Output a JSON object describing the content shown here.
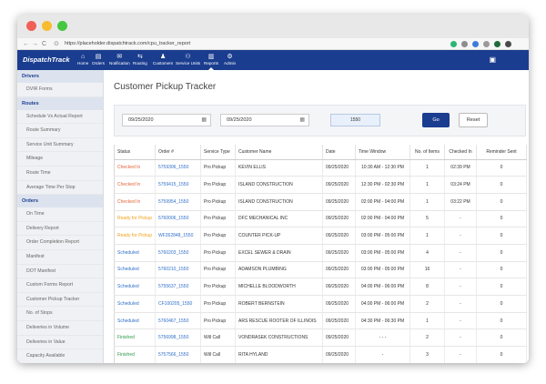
{
  "browser": {
    "url": "https://placeholder.dispatchtrack.com/cpu_tracker_report",
    "nav": {
      "back": "←",
      "forward": "→",
      "reload": "C",
      "lock": "⊙"
    },
    "extensions": [
      {
        "name": "ext-green",
        "color": "#2bb673"
      },
      {
        "name": "ext-gray",
        "color": "#8d8d8d"
      },
      {
        "name": "ext-blue",
        "color": "#3d7dd8"
      },
      {
        "name": "ext-puzzle",
        "color": "#9a9a9a"
      },
      {
        "name": "ext-darkgreen",
        "color": "#1f6b3a"
      },
      {
        "name": "ext-profile",
        "color": "#4a4a4a"
      }
    ]
  },
  "app": {
    "logo": "DispatchTrack",
    "nav": [
      {
        "label": "Home",
        "icon": "home-icon",
        "glyph": "⌂"
      },
      {
        "label": "Orders",
        "icon": "orders-icon",
        "glyph": "▤"
      },
      {
        "label": "Notification",
        "icon": "notification-icon",
        "glyph": "✉"
      },
      {
        "label": "Routing",
        "icon": "routing-icon",
        "glyph": "⇆"
      },
      {
        "label": "Customers",
        "icon": "customers-icon",
        "glyph": "♟"
      },
      {
        "label": "Service Units",
        "icon": "service-units-icon",
        "glyph": "⚇"
      },
      {
        "label": "Reports",
        "icon": "reports-icon",
        "glyph": "▥"
      },
      {
        "label": "Admin",
        "icon": "admin-icon",
        "glyph": "⚙"
      }
    ],
    "active_nav": "Reports",
    "user_glyph": "▣",
    "brand_color": "#1b3d8f"
  },
  "sidebar": {
    "sections": [
      {
        "title": "Drivers",
        "items": [
          "DVIR Forms"
        ]
      },
      {
        "title": "Routes",
        "items": [
          "Schedule Vs Actual Report",
          "Route Summary",
          "Service Unit Summary",
          "Mileage",
          "Route Time",
          "Average Time Per Stop"
        ]
      },
      {
        "title": "Orders",
        "items": [
          "On Time",
          "Delivery Report",
          "Order Completion Report",
          "Manifest",
          "DOT Manifest",
          "Custom Forms Report",
          "Customer Pickup Tracker",
          "No. of Stops",
          "Deliveries in Volume",
          "Deliveries in Value",
          "Capacity Available"
        ]
      }
    ]
  },
  "main": {
    "title": "Customer Pickup Tracker",
    "filters": {
      "start_date": "09/25/2020",
      "end_date": "09/25/2020",
      "store": "1550",
      "calendar_glyph": "▦",
      "go_label": "Go",
      "reset_label": "Reset"
    },
    "table": {
      "columns": [
        "Status",
        "Order #",
        "Service Type",
        "Customer Name",
        "Date",
        "Time Window",
        "No. of Items",
        "Checked In",
        "Reminder Sent"
      ],
      "rows": [
        {
          "status": "Checked In",
          "status_class": "st-checked",
          "order": "5759306_1550",
          "service": "Pro Pickup",
          "customer": "KEVIN ELLIS",
          "date": "09/25/2020",
          "window": "10:30 AM - 12:30 PM",
          "items": "1",
          "checked_in": "02:39 PM",
          "reminder": "0"
        },
        {
          "status": "Checked In",
          "status_class": "st-checked",
          "order": "5759415_1550",
          "service": "Pro Pickup",
          "customer": "ISLAND CONSTRUCTION",
          "date": "09/25/2020",
          "window": "12:30 PM - 02:30 PM",
          "items": "1",
          "checked_in": "03:24 PM",
          "reminder": "0"
        },
        {
          "status": "Checked In",
          "status_class": "st-checked",
          "order": "5759954_1550",
          "service": "Pro Pickup",
          "customer": "ISLAND CONSTRUCTION",
          "date": "09/25/2020",
          "window": "02:00 PM - 04:00 PM",
          "items": "1",
          "checked_in": "03:22 PM",
          "reminder": "0"
        },
        {
          "status": "Ready for Pickup",
          "status_class": "st-ready",
          "order": "5760006_1550",
          "service": "Pro Pickup",
          "customer": "DFC MECHANICAL INC",
          "date": "09/25/2020",
          "window": "02:00 PM - 04:00 PM",
          "items": "5",
          "checked_in": "-",
          "reminder": "0"
        },
        {
          "status": "Ready for Pickup",
          "status_class": "st-ready",
          "order": "WF262848_1550",
          "service": "Pro Pickup",
          "customer": "COUNTER PICK-UP",
          "date": "09/25/2020",
          "window": "03:00 PM - 05:00 PM",
          "items": "1",
          "checked_in": "-",
          "reminder": "0"
        },
        {
          "status": "Scheduled",
          "status_class": "st-scheduled",
          "order": "5760203_1550",
          "service": "Pro Pickup",
          "customer": "EXCEL SEWER & DRAIN",
          "date": "09/25/2020",
          "window": "03:00 PM - 05:00 PM",
          "items": "4",
          "checked_in": "-",
          "reminder": "0"
        },
        {
          "status": "Scheduled",
          "status_class": "st-scheduled",
          "order": "5760210_1550",
          "service": "Pro Pickup",
          "customer": "ADAMSON PLUMBING",
          "date": "09/25/2020",
          "window": "03:00 PM - 05:00 PM",
          "items": "16",
          "checked_in": "-",
          "reminder": "0"
        },
        {
          "status": "Scheduled",
          "status_class": "st-scheduled",
          "order": "5755637_1550",
          "service": "Pro Pickup",
          "customer": "MICHELLE BLOODWORTH",
          "date": "09/25/2020",
          "window": "04:00 PM - 06:00 PM",
          "items": "8",
          "checked_in": "-",
          "reminder": "0"
        },
        {
          "status": "Scheduled",
          "status_class": "st-scheduled",
          "order": "CF100205_1550",
          "service": "Pro Pickup",
          "customer": "ROBERT BERNSTEIN",
          "date": "09/25/2020",
          "window": "04:00 PM - 06:00 PM",
          "items": "2",
          "checked_in": "-",
          "reminder": "0"
        },
        {
          "status": "Scheduled",
          "status_class": "st-scheduled",
          "order": "5760467_1550",
          "service": "Pro Pickup",
          "customer": "ARS RESCUE ROOTER OF ILLINOIS",
          "date": "09/25/2020",
          "window": "04:30 PM - 06:30 PM",
          "items": "1",
          "checked_in": "-",
          "reminder": "0"
        },
        {
          "status": "Finished",
          "status_class": "st-finished",
          "order": "5756998_1550",
          "service": "Will Call",
          "customer": "VONDRASEK CONSTRUCTIONS",
          "date": "09/25/2020",
          "window": "- - -",
          "items": "2",
          "checked_in": "-",
          "reminder": "0"
        },
        {
          "status": "Finished",
          "status_class": "st-finished",
          "order": "5757566_1550",
          "service": "Will Call",
          "customer": "RITA HYLAND",
          "date": "09/25/2020",
          "window": "-",
          "items": "3",
          "checked_in": "-",
          "reminder": "0"
        },
        {
          "status": "Finished",
          "status_class": "st-finished",
          "order": "5758549_1550",
          "service": "Will Call",
          "customer": "HEATER RIDGE CONTRACTORS INC",
          "date": "09/25/2020",
          "window": "-",
          "items": "1",
          "checked_in": "-",
          "reminder": "0"
        }
      ]
    }
  }
}
